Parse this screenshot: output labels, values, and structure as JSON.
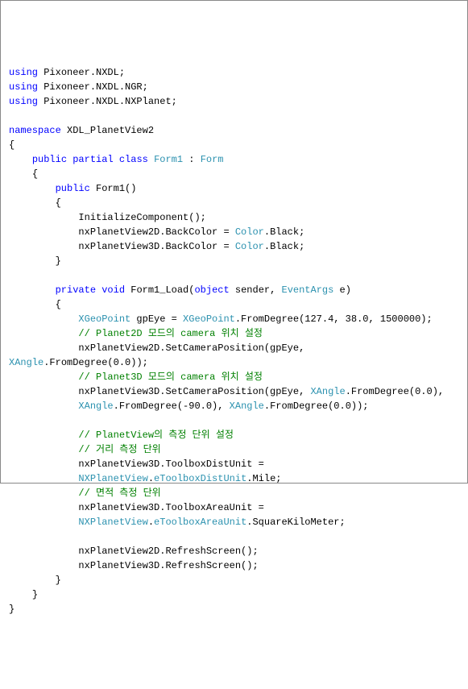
{
  "code": {
    "lines": [
      {
        "indent": 0,
        "segments": [
          {
            "t": "using",
            "c": "kw-blue"
          },
          {
            "t": " Pixoneer.NXDL;",
            "c": "kw-black"
          }
        ]
      },
      {
        "indent": 0,
        "segments": [
          {
            "t": "using",
            "c": "kw-blue"
          },
          {
            "t": " Pixoneer.NXDL.NGR;",
            "c": "kw-black"
          }
        ]
      },
      {
        "indent": 0,
        "segments": [
          {
            "t": "using",
            "c": "kw-blue"
          },
          {
            "t": " Pixoneer.NXDL.NXPlanet;",
            "c": "kw-black"
          }
        ]
      },
      {
        "indent": 0,
        "segments": [
          {
            "t": " ",
            "c": "kw-black"
          }
        ]
      },
      {
        "indent": 0,
        "segments": [
          {
            "t": "namespace",
            "c": "kw-blue"
          },
          {
            "t": " XDL_PlanetView2",
            "c": "kw-black"
          }
        ]
      },
      {
        "indent": 0,
        "segments": [
          {
            "t": "{",
            "c": "kw-black"
          }
        ]
      },
      {
        "indent": 1,
        "segments": [
          {
            "t": "public",
            "c": "kw-blue"
          },
          {
            "t": " ",
            "c": "kw-black"
          },
          {
            "t": "partial",
            "c": "kw-blue"
          },
          {
            "t": " ",
            "c": "kw-black"
          },
          {
            "t": "class",
            "c": "kw-blue"
          },
          {
            "t": " ",
            "c": "kw-black"
          },
          {
            "t": "Form1",
            "c": "kw-teal"
          },
          {
            "t": " : ",
            "c": "kw-black"
          },
          {
            "t": "Form",
            "c": "kw-teal"
          }
        ]
      },
      {
        "indent": 1,
        "segments": [
          {
            "t": "{",
            "c": "kw-black"
          }
        ]
      },
      {
        "indent": 2,
        "segments": [
          {
            "t": "public",
            "c": "kw-blue"
          },
          {
            "t": " Form1()",
            "c": "kw-black"
          }
        ]
      },
      {
        "indent": 2,
        "segments": [
          {
            "t": "{",
            "c": "kw-black"
          }
        ]
      },
      {
        "indent": 3,
        "segments": [
          {
            "t": "InitializeComponent();",
            "c": "kw-black"
          }
        ]
      },
      {
        "indent": 3,
        "segments": [
          {
            "t": "nxPlanetView2D.BackColor = ",
            "c": "kw-black"
          },
          {
            "t": "Color",
            "c": "kw-teal"
          },
          {
            "t": ".Black;",
            "c": "kw-black"
          }
        ]
      },
      {
        "indent": 3,
        "segments": [
          {
            "t": "nxPlanetView3D.BackColor = ",
            "c": "kw-black"
          },
          {
            "t": "Color",
            "c": "kw-teal"
          },
          {
            "t": ".Black;",
            "c": "kw-black"
          }
        ]
      },
      {
        "indent": 2,
        "segments": [
          {
            "t": "}",
            "c": "kw-black"
          }
        ]
      },
      {
        "indent": 0,
        "segments": [
          {
            "t": " ",
            "c": "kw-black"
          }
        ]
      },
      {
        "indent": 2,
        "segments": [
          {
            "t": "private",
            "c": "kw-blue"
          },
          {
            "t": " ",
            "c": "kw-black"
          },
          {
            "t": "void",
            "c": "kw-blue"
          },
          {
            "t": " Form1_Load(",
            "c": "kw-black"
          },
          {
            "t": "object",
            "c": "kw-blue"
          },
          {
            "t": " sender, ",
            "c": "kw-black"
          },
          {
            "t": "EventArgs",
            "c": "kw-teal"
          },
          {
            "t": " e)",
            "c": "kw-black"
          }
        ]
      },
      {
        "indent": 2,
        "segments": [
          {
            "t": "{",
            "c": "kw-black"
          }
        ]
      },
      {
        "indent": 3,
        "segments": [
          {
            "t": "XGeoPoint",
            "c": "kw-teal"
          },
          {
            "t": " gpEye = ",
            "c": "kw-black"
          },
          {
            "t": "XGeoPoint",
            "c": "kw-teal"
          },
          {
            "t": ".FromDegree(127.4, 38.0, 1500000);",
            "c": "kw-black"
          }
        ]
      },
      {
        "indent": 3,
        "segments": [
          {
            "t": "// Planet2D 모드의 camera 위치 설정",
            "c": "kw-green"
          }
        ]
      },
      {
        "indent": 3,
        "segments": [
          {
            "t": "nxPlanetView2D.SetCameraPosition(gpEye, ",
            "c": "kw-black"
          }
        ]
      },
      {
        "indent": -1,
        "segments": [
          {
            "t": "XAngle",
            "c": "kw-teal"
          },
          {
            "t": ".FromDegree(0.0));",
            "c": "kw-black"
          }
        ]
      },
      {
        "indent": 3,
        "segments": [
          {
            "t": "// Planet3D 모드의 camera 위치 설정",
            "c": "kw-green"
          }
        ]
      },
      {
        "indent": 3,
        "segments": [
          {
            "t": "nxPlanetView3D.SetCameraPosition(gpEye, ",
            "c": "kw-black"
          },
          {
            "t": "XAngle",
            "c": "kw-teal"
          },
          {
            "t": ".FromDegree(0.0), ",
            "c": "kw-black"
          }
        ]
      },
      {
        "indent": 3,
        "segments": [
          {
            "t": "XAngle",
            "c": "kw-teal"
          },
          {
            "t": ".FromDegree(-90.0), ",
            "c": "kw-black"
          },
          {
            "t": "XAngle",
            "c": "kw-teal"
          },
          {
            "t": ".FromDegree(0.0));",
            "c": "kw-black"
          }
        ]
      },
      {
        "indent": 0,
        "segments": [
          {
            "t": " ",
            "c": "kw-black"
          }
        ]
      },
      {
        "indent": 3,
        "segments": [
          {
            "t": "// PlanetView의 측정 단위 설정",
            "c": "kw-green"
          }
        ]
      },
      {
        "indent": 3,
        "segments": [
          {
            "t": "// 거리 측정 단위",
            "c": "kw-green"
          }
        ]
      },
      {
        "indent": 3,
        "segments": [
          {
            "t": "nxPlanetView3D.ToolboxDistUnit = ",
            "c": "kw-black"
          }
        ]
      },
      {
        "indent": 3,
        "segments": [
          {
            "t": "NXPlanetView",
            "c": "kw-teal"
          },
          {
            "t": ".",
            "c": "kw-black"
          },
          {
            "t": "eToolboxDistUnit",
            "c": "kw-teal"
          },
          {
            "t": ".Mile;",
            "c": "kw-black"
          }
        ]
      },
      {
        "indent": 3,
        "segments": [
          {
            "t": "// 면적 측정 단위",
            "c": "kw-green"
          }
        ]
      },
      {
        "indent": 3,
        "segments": [
          {
            "t": "nxPlanetView3D.ToolboxAreaUnit = ",
            "c": "kw-black"
          }
        ]
      },
      {
        "indent": 3,
        "segments": [
          {
            "t": "NXPlanetView",
            "c": "kw-teal"
          },
          {
            "t": ".",
            "c": "kw-black"
          },
          {
            "t": "eToolboxAreaUnit",
            "c": "kw-teal"
          },
          {
            "t": ".SquareKiloMeter;",
            "c": "kw-black"
          }
        ]
      },
      {
        "indent": 0,
        "segments": [
          {
            "t": " ",
            "c": "kw-black"
          }
        ]
      },
      {
        "indent": 3,
        "segments": [
          {
            "t": "nxPlanetView2D.RefreshScreen();",
            "c": "kw-black"
          }
        ]
      },
      {
        "indent": 3,
        "segments": [
          {
            "t": "nxPlanetView3D.RefreshScreen();",
            "c": "kw-black"
          }
        ]
      },
      {
        "indent": 2,
        "segments": [
          {
            "t": "}",
            "c": "kw-black"
          }
        ]
      },
      {
        "indent": 1,
        "segments": [
          {
            "t": "}",
            "c": "kw-black"
          }
        ]
      },
      {
        "indent": 0,
        "segments": [
          {
            "t": "}",
            "c": "kw-black"
          }
        ]
      }
    ]
  }
}
